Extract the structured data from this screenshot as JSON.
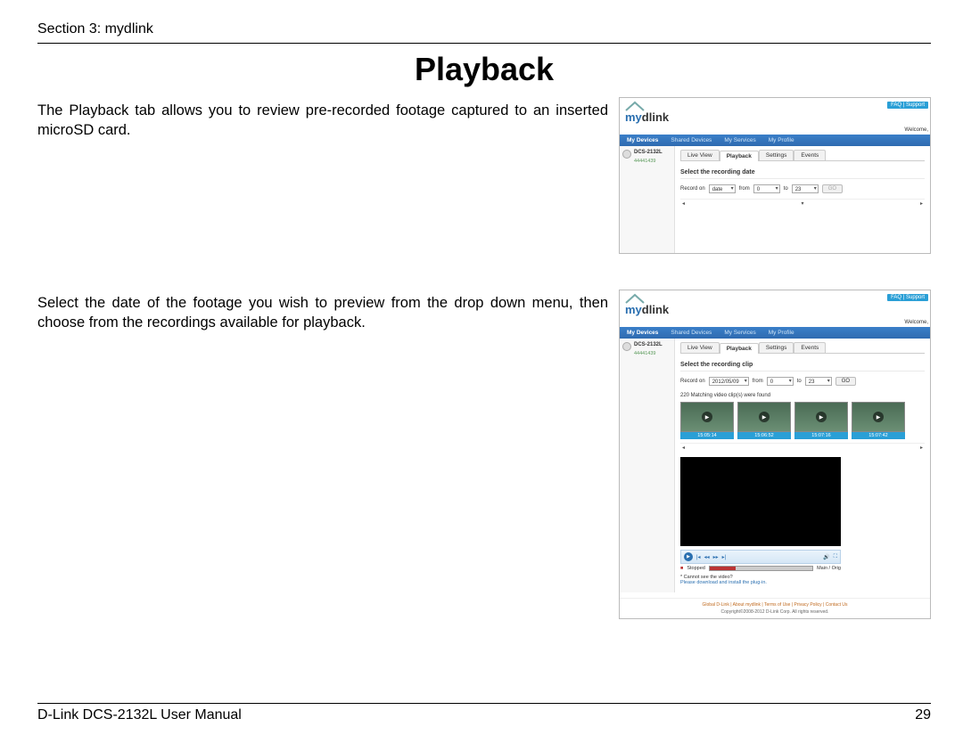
{
  "section_header": "Section 3: mydlink",
  "title": "Playback",
  "para1": "The Playback tab allows you to review pre-recorded footage captured to an inserted microSD card.",
  "para2": "Select the date of the footage you wish to preview from the drop down menu, then choose from the recordings available for playback.",
  "footer_left": "D-Link DCS-2132L User Manual",
  "footer_right": "29",
  "shot": {
    "logo_my": "my",
    "logo_dlink": "dlink",
    "faq": "FAQ | Support",
    "welcome": "Welcome,",
    "nav": {
      "devices": "My Devices",
      "shared": "Shared Devices",
      "services": "My Services",
      "profile": "My Profile"
    },
    "device": {
      "name": "DCS-2132L",
      "id": "44441439"
    },
    "tabs": {
      "live": "Live View",
      "playback": "Playback",
      "settings": "Settings",
      "events": "Events"
    },
    "panel1": {
      "title": "Select the recording date",
      "record_on": "Record on",
      "date_sel": "date",
      "from": "from",
      "from_val": "0",
      "to": "to",
      "to_val": "23",
      "go": "GO"
    },
    "panel2": {
      "title": "Select the recording clip",
      "record_on": "Record on",
      "date_sel": "2012/05/09",
      "from": "from",
      "from_val": "0",
      "to": "to",
      "to_val": "23",
      "go": "GO",
      "match": "220 Matching video clip(s) were found",
      "thumbs": [
        "15:05:14",
        "15:06:52",
        "15:07:16",
        "15:07:42"
      ],
      "stop": "Stopped",
      "res": "Main / Orig",
      "note_star": "* Cannot see the video?",
      "note_link": "Please download and install the plug-in."
    },
    "foot_links": "Global D-Link  |  About mydlink  |  Terms of Use  |  Privacy Policy  |  Contact Us",
    "copyright": "Copyright©2008-2012 D-Link Corp. All rights reserved."
  }
}
